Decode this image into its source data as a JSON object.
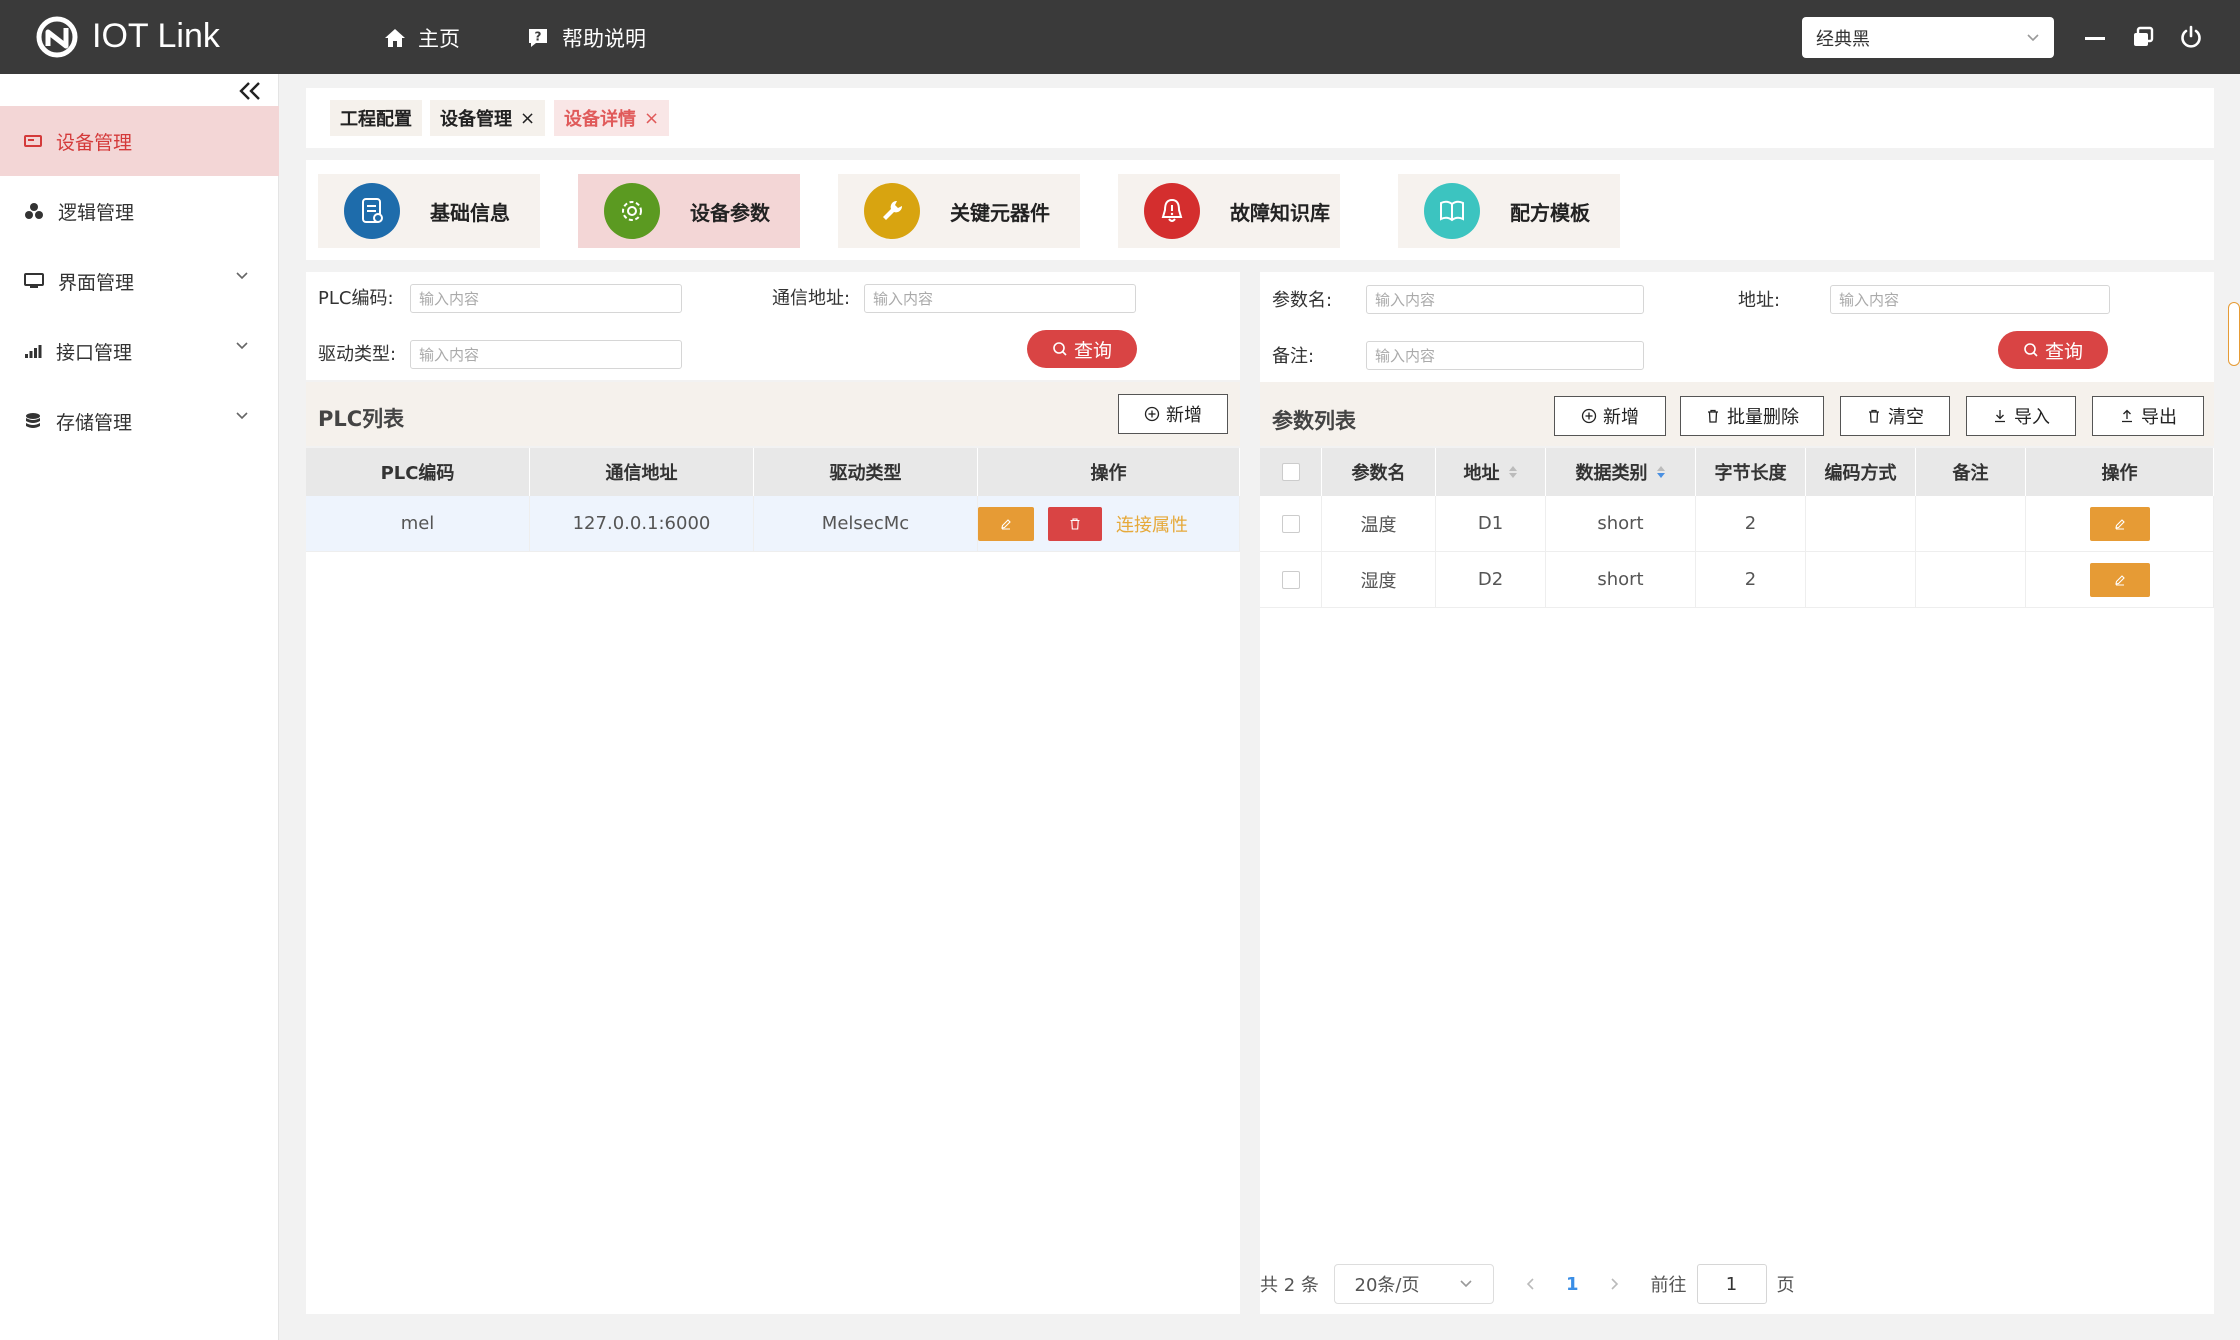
{
  "app": {
    "title": "IOT Link"
  },
  "topnav": {
    "home": "主页",
    "help": "帮助说明",
    "theme": "经典黑"
  },
  "sidebar": {
    "items": [
      {
        "label": "设备管理"
      },
      {
        "label": "逻辑管理"
      },
      {
        "label": "界面管理"
      },
      {
        "label": "接口管理"
      },
      {
        "label": "存储管理"
      }
    ]
  },
  "tabs": {
    "proj": "工程配置",
    "devmgr": "设备管理",
    "detail": "设备详情",
    "close": "×"
  },
  "categories": {
    "basic": "基础信息",
    "params": "设备参数",
    "key": "关键元器件",
    "fault": "故障知识库",
    "recipe": "配方模板"
  },
  "plc_search": {
    "code_label": "PLC编码:",
    "addr_label": "通信地址:",
    "driver_label": "驱动类型:",
    "placeholder": "输入内容",
    "query": "查询"
  },
  "param_search": {
    "name_label": "参数名:",
    "addr_label": "地址:",
    "remark_label": "备注:",
    "placeholder": "输入内容",
    "query": "查询"
  },
  "plc_list": {
    "title": "PLC列表",
    "add": "新增",
    "columns": [
      "PLC编码",
      "通信地址",
      "驱动类型",
      "操作"
    ],
    "rows": [
      {
        "code": "mel",
        "addr": "127.0.0.1:6000",
        "driver": "MelsecMc",
        "link": "连接属性"
      }
    ]
  },
  "param_list": {
    "title": "参数列表",
    "add": "新增",
    "batch_delete": "批量删除",
    "clear": "清空",
    "import": "导入",
    "export": "导出",
    "columns": [
      "参数名",
      "地址",
      "数据类别",
      "字节长度",
      "编码方式",
      "备注",
      "操作"
    ],
    "rows": [
      {
        "name": "温度",
        "addr": "D1",
        "type": "short",
        "len": "2",
        "enc": "",
        "remark": ""
      },
      {
        "name": "湿度",
        "addr": "D2",
        "type": "short",
        "len": "2",
        "enc": "",
        "remark": ""
      }
    ]
  },
  "pager": {
    "total": "共 2 条",
    "page_size": "20条/页",
    "current": "1",
    "goto": "前往",
    "goto_value": "1",
    "page_unit": "页"
  },
  "colors": {
    "topbar": "#3a3a3a",
    "accent_red": "#d94444",
    "edit_orange": "#e69b35",
    "active_bg": "#f3d6d6"
  }
}
